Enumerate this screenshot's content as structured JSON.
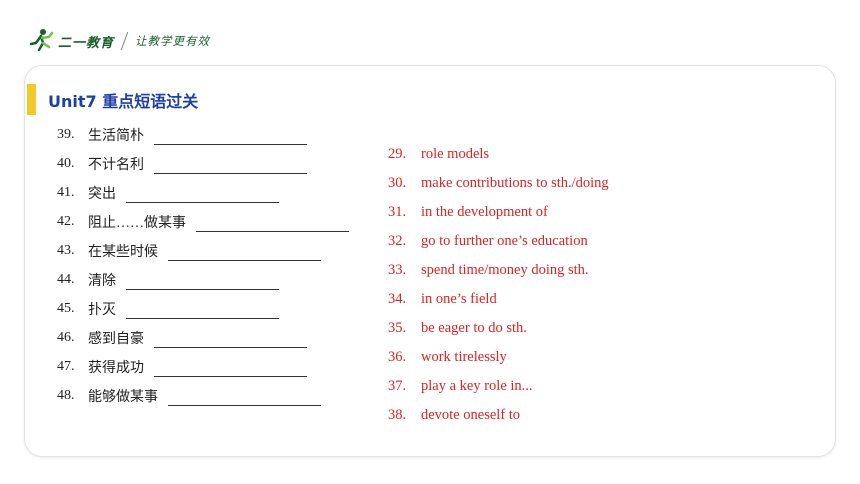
{
  "header": {
    "brand": "二一教育",
    "slogan": "让教学更有效",
    "brand_color": "#1a5e2a"
  },
  "page_title": "Unit7 重点短语过关",
  "accent_color": "#f3c829",
  "title_color": "#1e3fa3",
  "answer_color": "#d82424",
  "exercises": [
    {
      "num": "39.",
      "term": "生活简朴"
    },
    {
      "num": "40.",
      "term": "不计名利"
    },
    {
      "num": "41.",
      "term": "突出"
    },
    {
      "num": "42.",
      "term": "阻止……做某事"
    },
    {
      "num": "43.",
      "term": "在某些时候"
    },
    {
      "num": "44.",
      "term": "清除"
    },
    {
      "num": "45.",
      "term": "扑灭"
    },
    {
      "num": "46.",
      "term": "感到自豪"
    },
    {
      "num": "47.",
      "term": "获得成功"
    },
    {
      "num": "48.",
      "term": "能够做某事"
    }
  ],
  "answers": [
    {
      "num": "29.",
      "text": "role models"
    },
    {
      "num": "30.",
      "text": "make contributions to sth./doing"
    },
    {
      "num": "31.",
      "text": "in the development of"
    },
    {
      "num": "32.",
      "text": "go to further one’s education"
    },
    {
      "num": "33.",
      "text": "spend time/money doing sth."
    },
    {
      "num": "34.",
      "text": "in one’s field"
    },
    {
      "num": "35.",
      "text": "be eager to do sth."
    },
    {
      "num": "36.",
      "text": "work tirelessly"
    },
    {
      "num": "37.",
      "text": "play a key role in..."
    },
    {
      "num": "38.",
      "text": "devote oneself to"
    }
  ]
}
